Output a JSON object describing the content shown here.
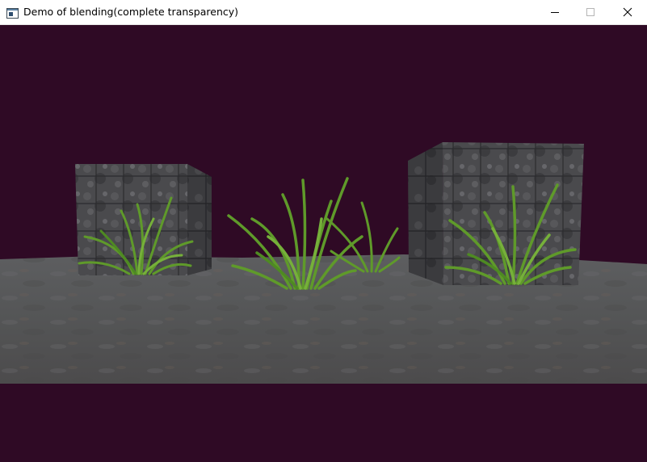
{
  "window": {
    "title": "Demo of blending(complete transparency)",
    "icons": {
      "app": "app-window-icon",
      "minimize": "minimize-icon",
      "maximize": "maximize-icon",
      "close": "close-icon"
    }
  },
  "scene": {
    "clear_color": "#2f0a25",
    "floor_color": "#5e5f60",
    "cube_color": "#47474a",
    "grass_color": "#5f9a2a",
    "objects": [
      "floor",
      "cube-left",
      "cube-right",
      "grass-left",
      "grass-center",
      "grass-center-back",
      "grass-right"
    ]
  }
}
